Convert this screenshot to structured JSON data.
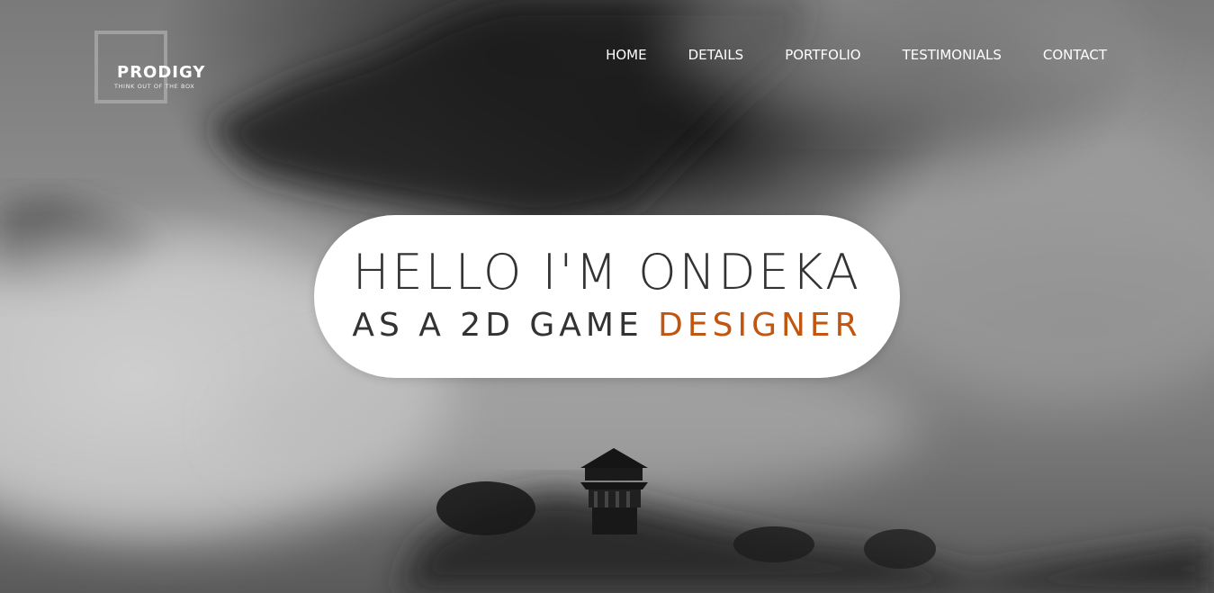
{
  "logo": {
    "title": "PRODIGY",
    "tagline": "THINK OUT OF THE BOX"
  },
  "nav": {
    "items": [
      "HOME",
      "DETAILS",
      "PORTFOLIO",
      "TESTIMONIALS",
      "CONTACT"
    ]
  },
  "hero": {
    "headline": "HELLO I'M ONDEKA",
    "subline_prefix": "AS A 2D GAME",
    "subline_accent": "DESIGNER"
  },
  "colors": {
    "accent": "#c0560f",
    "pill_background": "#ffffff",
    "heading_text": "#333333"
  }
}
